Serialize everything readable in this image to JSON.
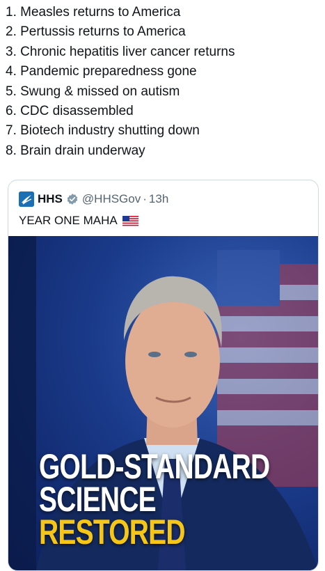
{
  "tweet": {
    "list_items": [
      "1. Measles returns to America",
      "2. Pertussis returns to America",
      "3. Chronic hepatitis liver cancer returns",
      "4. Pandemic preparedness gone",
      "5. Swung & missed on autism",
      "6. CDC disassembled",
      "7.  Biotech industry shutting down",
      "8. Brain drain underway"
    ]
  },
  "quote": {
    "author_name": "HHS",
    "handle": "@HHSGov",
    "separator": "·",
    "time": "13h",
    "text": "YEAR ONE MAHA",
    "flag_icon": "us-flag-icon",
    "verified_icon": "verified-badge-icon",
    "verified_color": "#829aab",
    "logo_color": "#1a6fb5",
    "image": {
      "line1": "GOLD-STANDARD",
      "line2": "SCIENCE",
      "line3": "RESTORED",
      "line3_color": "#f5c518"
    }
  }
}
